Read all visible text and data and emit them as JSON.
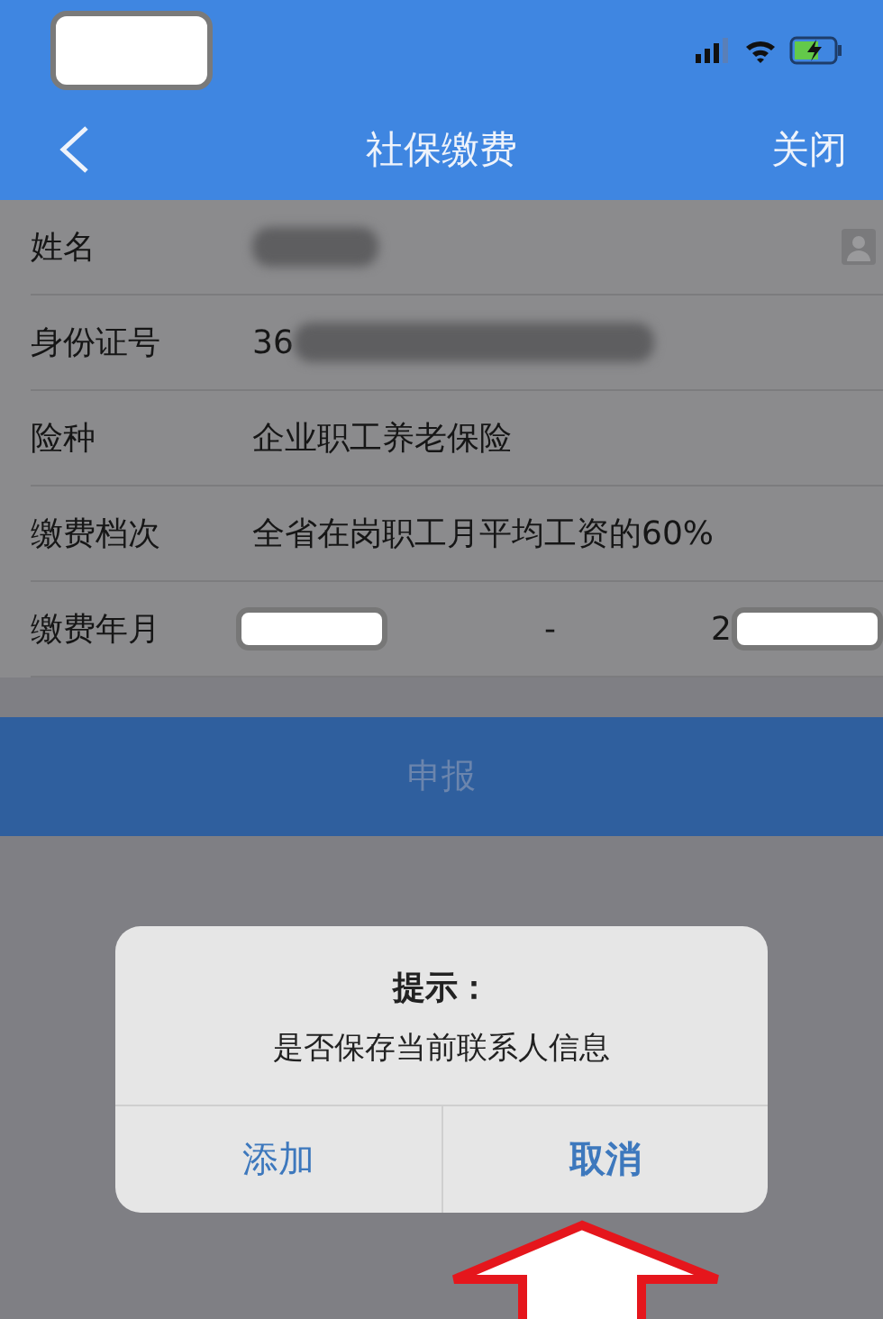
{
  "nav": {
    "title": "社保缴费",
    "close": "关闭"
  },
  "form": {
    "rows": [
      {
        "label": "姓名",
        "kind": "redacted-name"
      },
      {
        "label": "身份证号",
        "kind": "redacted-id",
        "value": "36"
      },
      {
        "label": "险种",
        "kind": "text",
        "value": "企业职工养老保险"
      },
      {
        "label": "缴费档次",
        "kind": "text",
        "value": "全省在岗职工月平均工资的60%"
      },
      {
        "label": "缴费年月",
        "kind": "range",
        "separator": "-",
        "end": "2"
      }
    ]
  },
  "submit": {
    "label": "申报"
  },
  "dialog": {
    "title": "提示：",
    "message": "是否保存当前联系人信息",
    "buttons": [
      {
        "label": "添加",
        "emphasized": false
      },
      {
        "label": "取消",
        "emphasized": true
      }
    ]
  }
}
